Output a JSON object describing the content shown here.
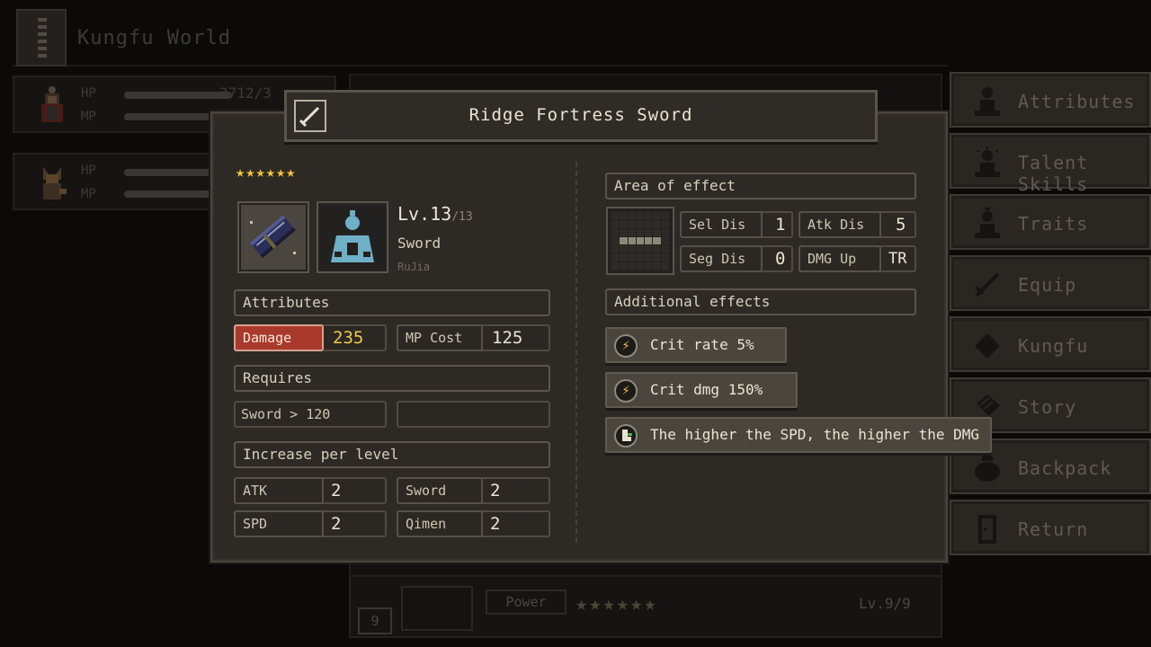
{
  "background": {
    "title": "Kungfu World",
    "characters": [
      {
        "hp_label": "HP",
        "mp_label": "MP",
        "hp_value": "3712/3"
      },
      {
        "hp_label": "HP",
        "mp_label": "MP"
      }
    ],
    "power_label": "Power",
    "power_stars": "★★★★★★",
    "level": "Lv.9/9",
    "slot_number": "9"
  },
  "menu": {
    "items": [
      {
        "label": "Attributes",
        "icon": "figure-icon"
      },
      {
        "label": "Talent Skills",
        "icon": "figure-spark-icon"
      },
      {
        "label": "Traits",
        "icon": "figure-heart-icon"
      },
      {
        "label": "Equip",
        "icon": "sword-icon"
      },
      {
        "label": "Kungfu",
        "icon": "book-icon"
      },
      {
        "label": "Story",
        "icon": "scroll-icon"
      },
      {
        "label": "Backpack",
        "icon": "bag-icon"
      },
      {
        "label": "Return",
        "icon": "door-icon"
      }
    ]
  },
  "skill": {
    "title": "Ridge Fortress Sword",
    "stars": "★★★★★★",
    "level": "Lv.13",
    "level_max": "/13",
    "type": "Sword",
    "sect": "RuJia",
    "attributes_header": "Attributes",
    "damage_label": "Damage",
    "damage_value": "235",
    "mp_cost_label": "MP Cost",
    "mp_cost_value": "125",
    "requires_header": "Requires",
    "requirement": "Sword > 120",
    "increase_header": "Increase per level",
    "increases": [
      {
        "label": "ATK",
        "value": "2"
      },
      {
        "label": "Sword",
        "value": "2"
      },
      {
        "label": "SPD",
        "value": "2"
      },
      {
        "label": "Qimen",
        "value": "2"
      }
    ],
    "area_header": "Area of effect",
    "area": [
      {
        "label": "Sel Dis",
        "value": "1"
      },
      {
        "label": "Atk Dis",
        "value": "5"
      },
      {
        "label": "Seg Dis",
        "value": "0"
      },
      {
        "label": "DMG Up",
        "value": "TR"
      }
    ],
    "additional_header": "Additional effects",
    "effects": [
      {
        "text": "Crit rate 5%",
        "icon": "lightning-icon"
      },
      {
        "text": "Crit dmg 150%",
        "icon": "lightning-icon"
      },
      {
        "text": "The higher the SPD, the higher the DMG",
        "icon": "boot-icon"
      }
    ]
  },
  "colors": {
    "damage_accent": "#a9392b",
    "star": "#f2c53a",
    "damage_value": "#f0c84a"
  }
}
